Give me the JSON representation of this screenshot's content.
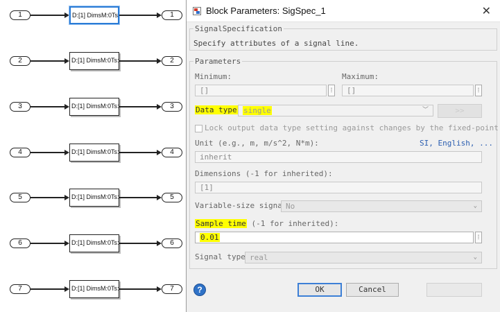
{
  "canvas": {
    "rows": [
      {
        "in_port": "1",
        "block_label": "D:[1] DimsM:0Ts:",
        "out_port": "1",
        "selected": true
      },
      {
        "in_port": "2",
        "block_label": "D:[1] DimsM:0Ts:",
        "out_port": "2"
      },
      {
        "in_port": "3",
        "block_label": "D:[1] DimsM:0Ts:",
        "out_port": "3"
      },
      {
        "in_port": "4",
        "block_label": "D:[1] DimsM:0Ts:",
        "out_port": "4"
      },
      {
        "in_port": "5",
        "block_label": "D:[1] DimsM:0Ts:",
        "out_port": "5"
      },
      {
        "in_port": "6",
        "block_label": "D:[1] DimsM:0Ts:",
        "out_port": "6"
      },
      {
        "in_port": "7",
        "block_label": "D:[1] DimsM:0Ts:",
        "out_port": "7"
      }
    ]
  },
  "dialog": {
    "title": "Block Parameters: SigSpec_1",
    "spec_group": "SignalSpecification",
    "spec_desc": "Specify attributes of a signal line.",
    "params_group": "Parameters",
    "minimum_label": "Minimum:",
    "minimum_value": "[]",
    "maximum_label": "Maximum:",
    "maximum_value": "[]",
    "datatype_label": "Data type:",
    "datatype_value": "single",
    "datatype_assistant": ">>",
    "lock_label": "Lock output data type setting against changes by the fixed-point t…",
    "unit_label": "Unit (e.g., m, m/s^2, N*m):",
    "unit_link": "SI, English, ...",
    "unit_value": "inherit",
    "dims_label": "Dimensions (-1 for inherited):",
    "dims_value": "[1]",
    "varsize_label": "Variable-size signal:",
    "varsize_value": "No",
    "sampletime_label": "Sample time",
    "sampletime_suffix": "(-1 for inherited):",
    "sampletime_value": "0.01",
    "sigtype_label": "Signal type:",
    "sigtype_value": "real",
    "ok": "OK",
    "cancel": "Cancel",
    "help": "?"
  },
  "colors": {
    "highlight": "#ffff00",
    "selection": "#2a7bd6",
    "link": "#2a5db0"
  }
}
